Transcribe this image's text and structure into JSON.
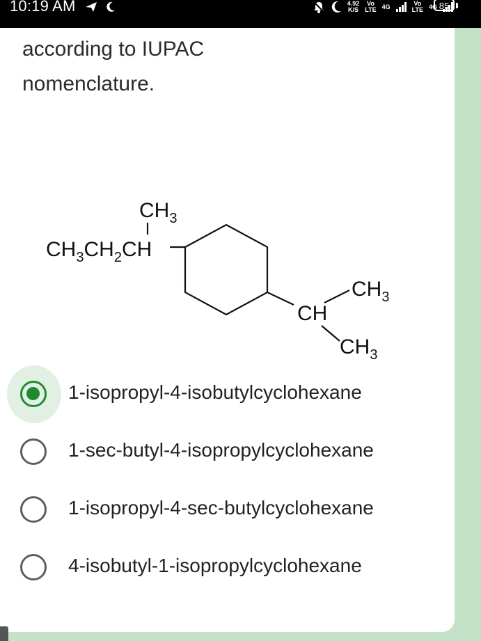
{
  "status_bar": {
    "time": "10:19 AM",
    "speed_value": "4.92",
    "speed_unit": "K/S",
    "sim1_vo": "Vo",
    "sim1_lte": "LTE",
    "sim1_net": "4G",
    "sim2_vo": "Vo",
    "sim2_lte": "LTE",
    "sim2_net": "4G",
    "battery": "85"
  },
  "question": {
    "line1": "according to IUPAC",
    "line2": "nomenclature."
  },
  "structure": {
    "top_methyl": "CH",
    "top_methyl_sub": "3",
    "chain_a": "CH",
    "chain_a_sub": "3",
    "chain_b": "CH",
    "chain_b_sub": "2",
    "chain_c": "CH",
    "isopropyl_ch": "CH",
    "isopropyl_me1": "CH",
    "isopropyl_me1_sub": "3",
    "isopropyl_me2": "CH",
    "isopropyl_me2_sub": "3"
  },
  "options": [
    {
      "label": "1-isopropyl-4-isobutylcyclohexane",
      "selected": true
    },
    {
      "label": "1-sec-butyl-4-isopropylcyclohexane",
      "selected": false
    },
    {
      "label": "1-isopropyl-4-sec-butylcyclohexane",
      "selected": false
    },
    {
      "label": "4-isobutyl-1-isopropylcyclohexane",
      "selected": false
    }
  ],
  "colors": {
    "accent": "#1f8a30",
    "background": "#c4e3c6",
    "card": "#ffffff"
  }
}
